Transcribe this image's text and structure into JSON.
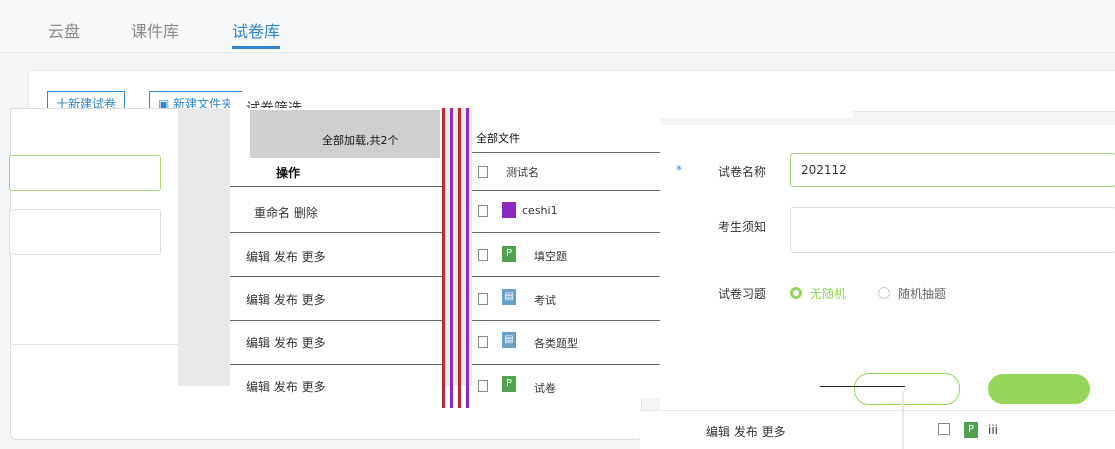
{
  "nav": {
    "tabs": [
      {
        "label": "云盘"
      },
      {
        "label": "课件库"
      },
      {
        "label": "试卷库"
      }
    ]
  },
  "toolbar": {
    "new_paper": "十新建试卷",
    "new_folder": "新建文件夹"
  },
  "modal": {
    "header_text": "试卷筛选"
  },
  "left_table": {
    "top_label": "全部加载,共2个",
    "header": "操作",
    "rows": [
      {
        "actions": "重命名 删除"
      },
      {
        "actions": "编辑 发布 更多"
      },
      {
        "actions": "编辑 发布 更多"
      },
      {
        "actions": "编辑 发布 更多"
      },
      {
        "actions": "编辑 发布 更多"
      }
    ]
  },
  "file_list": {
    "header": "全部文件",
    "items": [
      {
        "name": "测试名",
        "icon": "folder-icon"
      },
      {
        "name": "ceshi1",
        "icon": "folder-icon"
      },
      {
        "name": "填空题",
        "icon": "p-file-icon"
      },
      {
        "name": "考试",
        "icon": "doc-file-icon"
      },
      {
        "name": "各类题型",
        "icon": "doc-file-icon"
      },
      {
        "name": "试卷",
        "icon": "p-file-icon"
      }
    ]
  },
  "form": {
    "paper_name_label": "试卷名称",
    "paper_name_value": "202112",
    "notice_label": "考生须知",
    "questions_label": "试卷习题",
    "radio_no_random": "无随机",
    "radio_random": "随机抽题",
    "required_mark": "*"
  },
  "bottom": {
    "row_actions": "编辑 发布 更多",
    "right_item": "iii"
  },
  "colors": {
    "accent": "#2f86d0",
    "green": "#93d65a",
    "purple": "#8a2bbd",
    "red": "#b62d2d"
  }
}
